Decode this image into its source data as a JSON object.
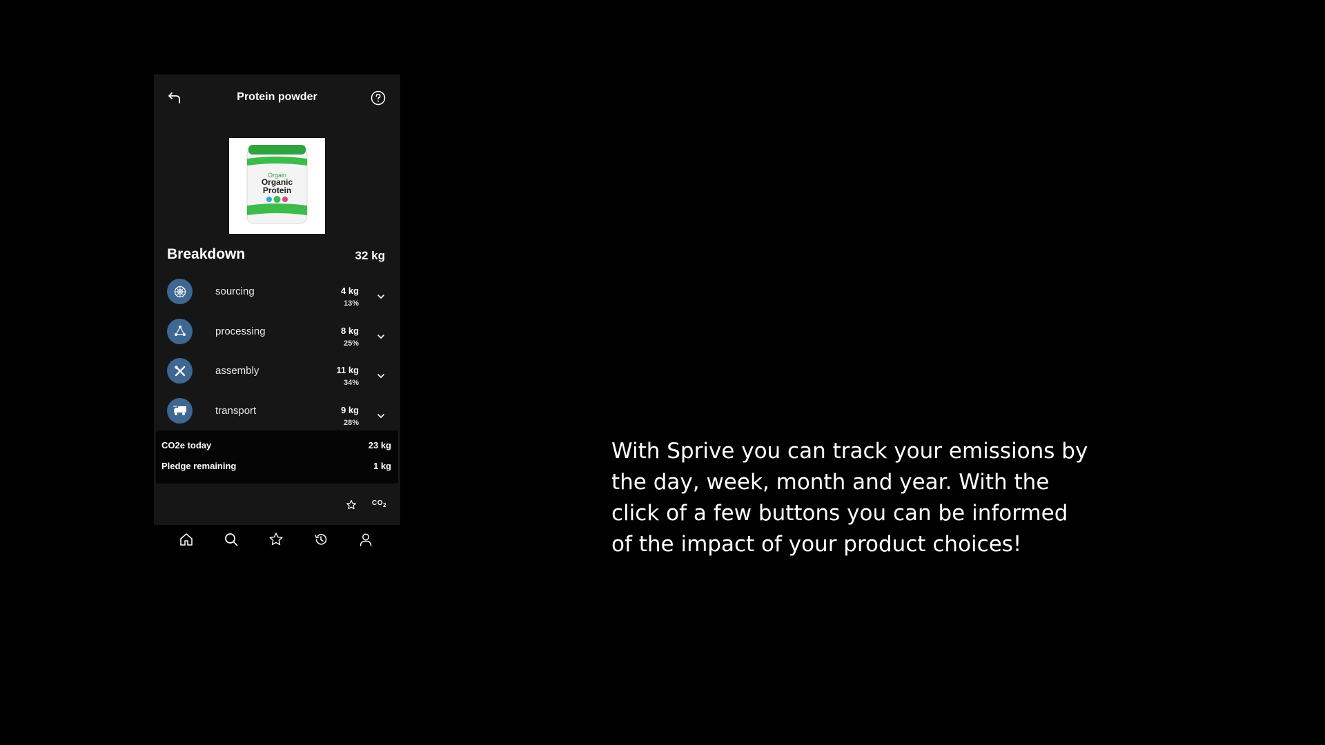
{
  "header": {
    "title": "Protein powder",
    "back_icon": "back-arrow-icon",
    "help_icon": "help-circle-icon"
  },
  "product": {
    "image": "protein-tub-product-image",
    "brand": "Orgain",
    "name_line1": "Organic",
    "name_line2": "Protein"
  },
  "breakdown": {
    "title": "Breakdown",
    "total": "32 kg",
    "items": [
      {
        "label": "sourcing",
        "kg": "4 kg",
        "pct": "13%",
        "icon": "sourcing-icon"
      },
      {
        "label": "processing",
        "kg": "8 kg",
        "pct": "25%",
        "icon": "processing-icon"
      },
      {
        "label": "assembly",
        "kg": "11 kg",
        "pct": "34%",
        "icon": "assembly-icon"
      },
      {
        "label": "transport",
        "kg": "9 kg",
        "pct": "28%",
        "icon": "truck-icon"
      }
    ]
  },
  "summary": {
    "co2_label": "CO2e today",
    "co2_value": "23 kg",
    "pledge_label": "Pledge remaining",
    "pledge_value": "1 kg"
  },
  "actions": {
    "favorite_icon": "star-icon",
    "co2_label": "CO",
    "co2_sub": "2"
  },
  "nav": {
    "items": [
      "home-icon",
      "search-icon",
      "star-icon",
      "history-icon",
      "profile-icon"
    ]
  },
  "caption": "With Sprive you can track your emissions by the day, week, month and year. With the click of a few buttons you can be informed of the impact of your product choices!",
  "colors": {
    "background": "#000000",
    "panel": "#161616",
    "accent": "#3e6791",
    "text": "#ffffff"
  }
}
